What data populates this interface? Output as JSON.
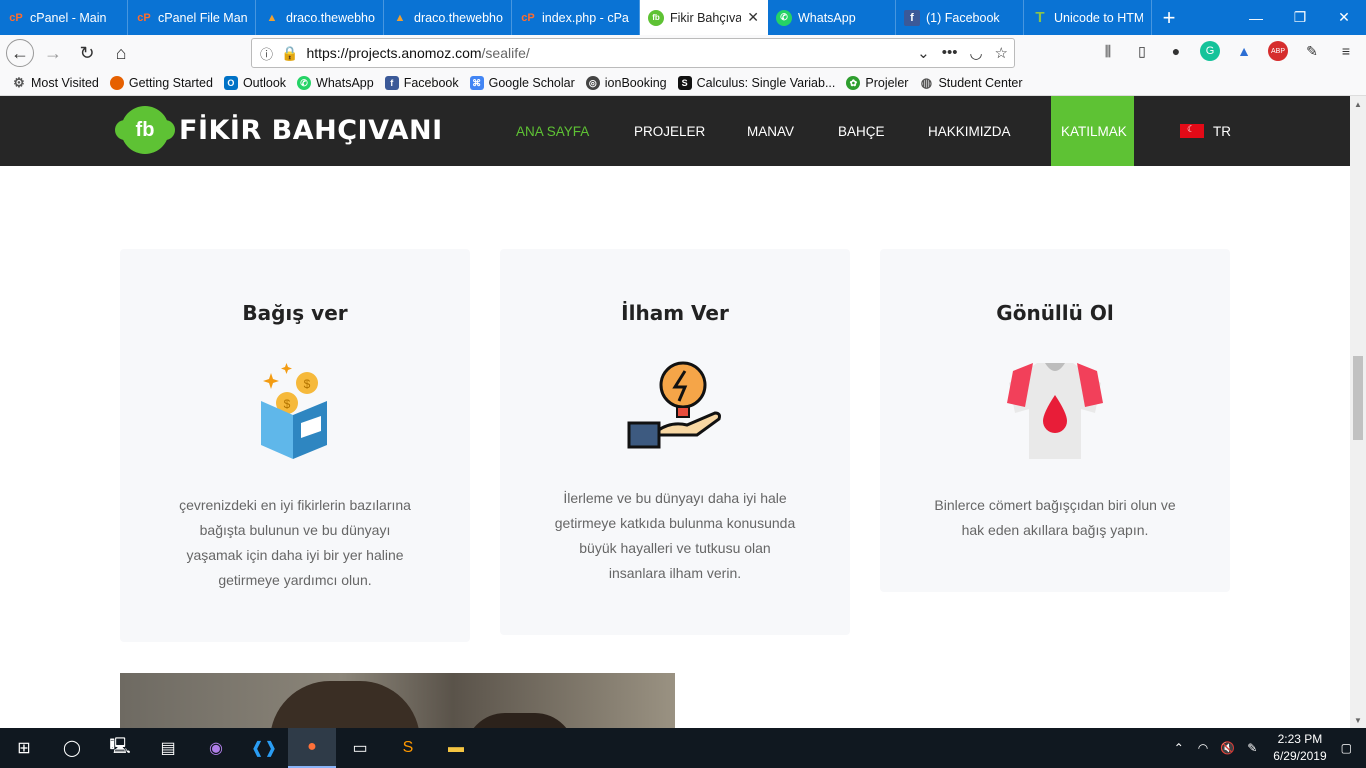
{
  "browser": {
    "tabs": [
      {
        "title": "cPanel - Main",
        "icon": "cpanel-icon",
        "color": "#ff6c2c"
      },
      {
        "title": "cPanel File Mana",
        "icon": "cpanel-icon",
        "color": "#ff6c2c"
      },
      {
        "title": "draco.thewebho",
        "icon": "draco-icon",
        "color": "#f0a030"
      },
      {
        "title": "draco.thewebho",
        "icon": "draco-icon",
        "color": "#f0a030"
      },
      {
        "title": "index.php - cPa",
        "icon": "cpanel-icon",
        "color": "#ff6c2c"
      },
      {
        "title": "Fikir Bahçıvan",
        "icon": "fikir-icon",
        "color": "#5ec234",
        "active": true
      },
      {
        "title": "WhatsApp",
        "icon": "whatsapp-icon",
        "color": "#25d366"
      },
      {
        "title": "(1) Facebook",
        "icon": "facebook-icon",
        "color": "#3b5998"
      },
      {
        "title": "Unicode to HTM",
        "icon": "unicode-icon",
        "color": "#8bc34a"
      }
    ],
    "url_host": "https://projects.anomoz.com",
    "url_path": "/sealife/",
    "bookmarks": [
      {
        "label": "Most Visited",
        "icon": "gear-icon",
        "color": "#555"
      },
      {
        "label": "Getting Started",
        "icon": "firefox-icon",
        "color": "#e66000"
      },
      {
        "label": "Outlook",
        "icon": "outlook-icon",
        "color": "#0072c6"
      },
      {
        "label": "WhatsApp",
        "icon": "whatsapp-icon",
        "color": "#25d366"
      },
      {
        "label": "Facebook",
        "icon": "facebook-icon",
        "color": "#3b5998"
      },
      {
        "label": "Google Scholar",
        "icon": "scholar-icon",
        "color": "#4285f4"
      },
      {
        "label": "ionBooking",
        "icon": "ion-icon",
        "color": "#444"
      },
      {
        "label": "Calculus: Single Variab...",
        "icon": "calculus-icon",
        "color": "#111"
      },
      {
        "label": "Projeler",
        "icon": "projeler-icon",
        "color": "#2e9e2e"
      },
      {
        "label": "Student Center",
        "icon": "globe-icon",
        "color": "#555"
      }
    ]
  },
  "site": {
    "logo_mark": "fb",
    "logo_text": "FİKİR BAHÇIVANI",
    "accent": "#5ec234",
    "nav": [
      {
        "label": "ANA SAYFA",
        "active": true
      },
      {
        "label": "PROJELER"
      },
      {
        "label": "MANAV"
      },
      {
        "label": "BAHÇE"
      },
      {
        "label": "HAKKIMIZDA"
      },
      {
        "label": "KATILMAK",
        "cta": true
      },
      {
        "label": "TR",
        "flag": true
      }
    ],
    "cards": [
      {
        "title": "Bağış ver",
        "icon": "donation-box-icon",
        "desc": [
          "çevrenizdeki en iyi fikirlerin bazılarına",
          "bağışta bulunun ve bu dünyayı",
          "yaşamak için daha iyi bir yer haline",
          "getirmeye yardımcı olun."
        ]
      },
      {
        "title": "İlham Ver",
        "icon": "idea-bulb-hand-icon",
        "desc": [
          "İlerleme ve bu dünyayı daha iyi hale",
          "getirmeye katkıda bulunma konusunda",
          "büyük hayalleri ve tutkusu olan",
          "insanlara ilham verin."
        ]
      },
      {
        "title": "Gönüllü Ol",
        "icon": "volunteer-shirt-icon",
        "desc": [
          "Binlerce cömert bağışçıdan biri olun ve",
          "hak eden akıllara bağış yapın."
        ]
      }
    ]
  },
  "taskbar": {
    "time": "2:23 PM",
    "date": "6/29/2019"
  }
}
